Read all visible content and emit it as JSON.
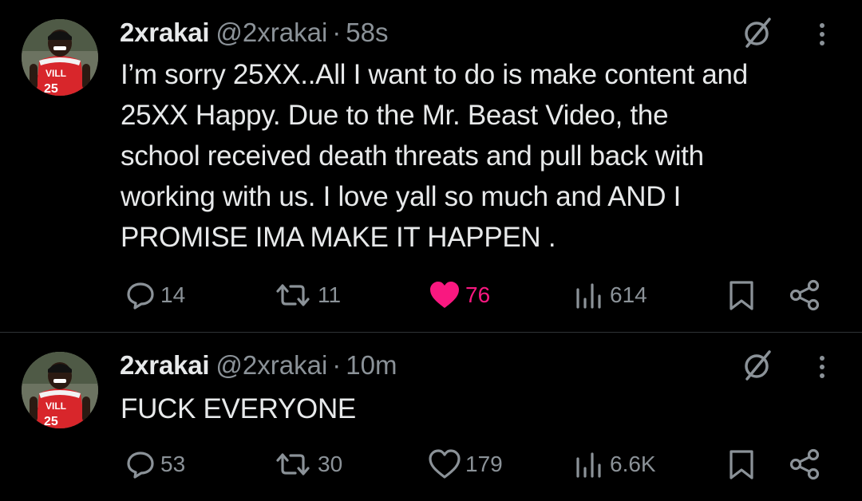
{
  "tweets": [
    {
      "display_name": "2xrakai",
      "handle": "@2xrakai",
      "separator": "·",
      "time": "58s",
      "text": "I’m sorry 25XX..All I want to do is make content and\n25XX Happy.  Due to the Mr. Beast Video, the\nschool received death threats and pull back with\nworking with us. I love yall so much and AND I\nPROMISE IMA MAKE IT HAPPEN .",
      "metrics": {
        "replies": "14",
        "reposts": "11",
        "likes": "76",
        "views": "614"
      },
      "liked": true
    },
    {
      "display_name": "2xrakai",
      "handle": "@2xrakai",
      "separator": "·",
      "time": "10m",
      "text": "FUCK EVERYONE",
      "metrics": {
        "replies": "53",
        "reposts": "30",
        "likes": "179",
        "views": "6.6K"
      },
      "liked": false
    }
  ],
  "icons": {
    "avatar": "profile-photo",
    "grok": "grok-slash-circle-icon",
    "more": "vertical-ellipsis-icon",
    "reply": "speech-bubble-icon",
    "repost": "repost-arrows-icon",
    "like": "heart-icon",
    "views": "bar-chart-icon",
    "bookmark": "bookmark-icon",
    "share": "share-icon"
  },
  "colors": {
    "background": "#000000",
    "text": "#e7e9ea",
    "muted": "#8b9298",
    "like_active": "#f91880",
    "divider": "#2f3336"
  }
}
